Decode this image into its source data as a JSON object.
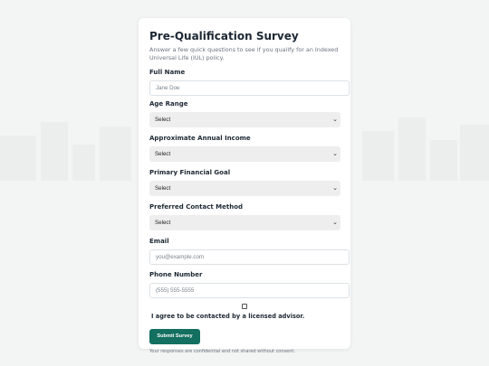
{
  "survey": {
    "title": "Pre-Qualification Survey",
    "subtitle": "Answer a few quick questions to see if you qualify for an Indexed Universal Life (IUL) policy.",
    "fields": {
      "full_name": {
        "label": "Full Name",
        "placeholder": "Jane Doe"
      },
      "age_range": {
        "label": "Age Range",
        "selected": "Select"
      },
      "income": {
        "label": "Approximate Annual Income",
        "selected": "Select"
      },
      "goal": {
        "label": "Primary Financial Goal",
        "selected": "Select"
      },
      "contact_method": {
        "label": "Preferred Contact Method",
        "selected": "Select"
      },
      "email": {
        "label": "Email",
        "placeholder": "you@example.com"
      },
      "phone": {
        "label": "Phone Number",
        "placeholder": "(555) 555-5555"
      }
    },
    "consent": {
      "label": "I agree to be contacted by a licensed advisor.",
      "checked": false
    },
    "submit_label": "Submit Survey",
    "privacy_note": "Your responses are confidential and not shared without consent."
  },
  "icons": {
    "select_arrow": "chevron-down-icon"
  },
  "colors": {
    "accent": "#136f5f",
    "background": "#f3f5f4",
    "card": "#ffffff"
  }
}
